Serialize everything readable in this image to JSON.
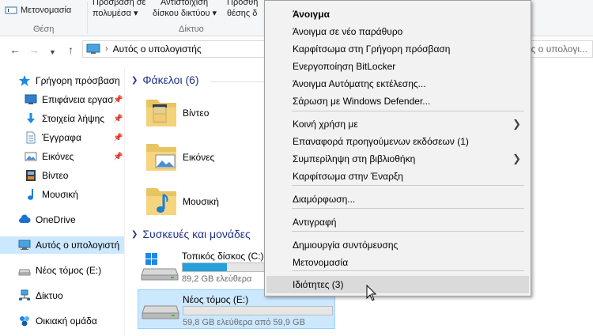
{
  "ribbon": {
    "rename_label": "Μετονομασία",
    "access_label_1": "Πρόσβαση σε",
    "access_label_2": "πολυμέσα ▾",
    "map_label_1": "Αντιστοίχιση",
    "map_label_2": "δίσκου δικτύου ▾",
    "add_label_1": "Προσθή",
    "add_label_2": "θέσης δ",
    "group_location": "Θέση",
    "group_network": "Δίκτυο"
  },
  "address": {
    "path": "Αυτός ο υπολογιστής",
    "search_placeholder": "Αυτός ο υπολογι..."
  },
  "sidebar": {
    "items": [
      {
        "label": "Γρήγορη πρόσβαση",
        "icon": "star-icon"
      },
      {
        "label": "Επιφάνεια εργασ",
        "icon": "desktop-icon",
        "pinned": true
      },
      {
        "label": "Στοιχεία λήψης",
        "icon": "download-icon",
        "pinned": true
      },
      {
        "label": "Έγγραφα",
        "icon": "document-icon",
        "pinned": true
      },
      {
        "label": "Εικόνες",
        "icon": "pictures-icon",
        "pinned": true
      },
      {
        "label": "Βίντεο",
        "icon": "video-icon"
      },
      {
        "label": "Μουσική",
        "icon": "music-icon"
      },
      {
        "label": "OneDrive",
        "icon": "cloud-icon"
      },
      {
        "label": "Αυτός ο υπολογιστή",
        "icon": "computer-icon",
        "selected": true
      },
      {
        "label": "Νέος τόμος (E:)",
        "icon": "drive-icon"
      },
      {
        "label": "Δίκτυο",
        "icon": "network-icon"
      },
      {
        "label": "Οικιακή ομάδα",
        "icon": "homegroup-icon"
      }
    ]
  },
  "main": {
    "folders_header": "Φάκελοι (6)",
    "folders": [
      {
        "label": "Βίντεο",
        "icon": "video-folder-icon"
      },
      {
        "label": "Εικόνες",
        "icon": "pictures-folder-icon"
      },
      {
        "label": "Μουσική",
        "icon": "music-folder-icon"
      }
    ],
    "devices_header": "Συσκευές και μονάδες",
    "drives": [
      {
        "name": "Τοπικός δίσκος (C:)",
        "free": "89,2 GB ελεύθερα",
        "used_fraction": 0.3,
        "selected": false
      },
      {
        "name": "Νέος τόμος (E:)",
        "free": "59,8 GB ελεύθερα από 59,9 GB",
        "used_fraction": 0.0,
        "selected": true
      }
    ]
  },
  "context_menu": {
    "items": [
      {
        "label": "Άνοιγμα",
        "bold": true
      },
      {
        "label": "Άνοιγμα σε νέο παράθυρο"
      },
      {
        "label": "Καρφίτσωμα στη Γρήγορη πρόσβαση"
      },
      {
        "label": "Ενεργοποίηση BitLocker"
      },
      {
        "label": "Άνοιγμα Αυτόματης εκτέλεσης..."
      },
      {
        "label": "Σάρωση με Windows Defender..."
      },
      {
        "label": "Κοινή χρήση με",
        "submenu": true
      },
      {
        "label": "Επαναφορά προηγούμενων εκδόσεων (1)"
      },
      {
        "label": "Συμπερίληψη στη βιβλιοθήκη",
        "submenu": true
      },
      {
        "label": "Καρφίτσωμα στην Έναρξη"
      },
      {
        "label": "Διαμόρφωση..."
      },
      {
        "label": "Αντιγραφή"
      },
      {
        "label": "Δημιουργία συντόμευσης"
      },
      {
        "label": "Μετονομασία"
      },
      {
        "label": "Ιδιότητες (3)",
        "hover": true
      }
    ]
  },
  "colors": {
    "accent": "#26a0da",
    "selection": "#cce8ff",
    "header_blue": "#1e3287"
  }
}
